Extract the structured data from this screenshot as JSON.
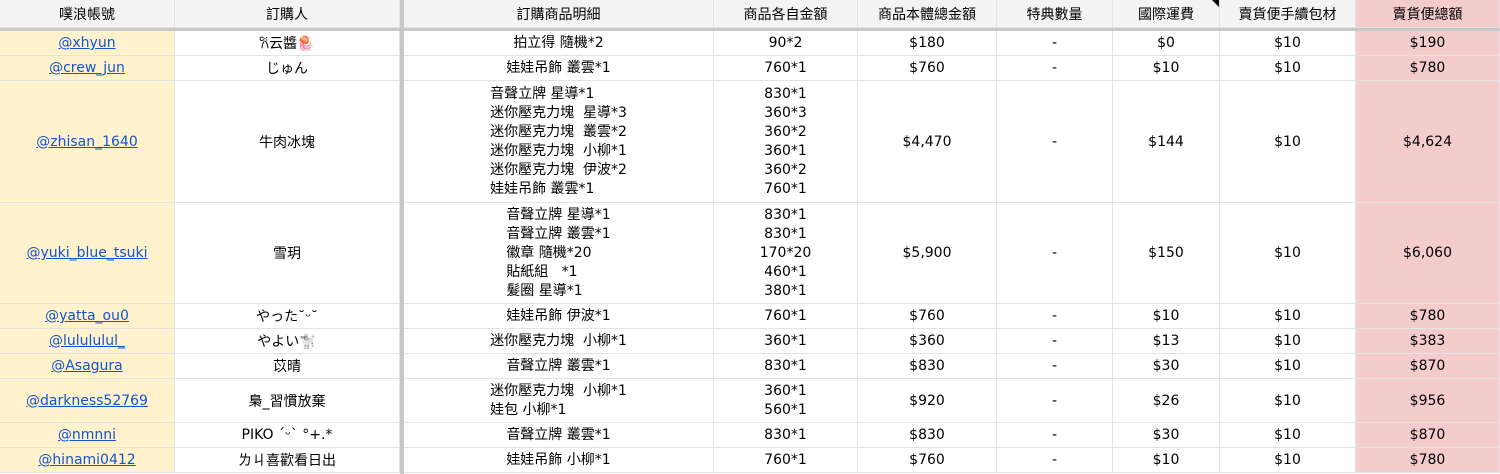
{
  "header": {
    "account": "噗浪帳號",
    "buyer": "訂購人",
    "items": "訂購商品明細",
    "unit_price": "商品各自金額",
    "subtotal": "商品本體總金額",
    "bonus": "特典數量",
    "shipping": "國際運費",
    "handling": "賣貨便手續包材",
    "total": "賣貨便總額"
  },
  "rows": [
    {
      "account": "@xhyun",
      "buyer": "𐙚云醬🪼",
      "items": [
        "拍立得 隨機*2"
      ],
      "prices": [
        "90*2"
      ],
      "subtotal": "$180",
      "bonus": "-",
      "shipping": "$0",
      "handling": "$10",
      "total": "$190"
    },
    {
      "account": "@crew_jun",
      "buyer": "じゅん",
      "items": [
        "娃娃吊飾 叢雲*1"
      ],
      "prices": [
        "760*1"
      ],
      "subtotal": "$760",
      "bonus": "-",
      "shipping": "$10",
      "handling": "$10",
      "total": "$780"
    },
    {
      "account": "@zhisan_1640",
      "buyer": "牛肉冰塊",
      "items": [
        "音聲立牌 星導*1",
        "迷你壓克力塊  星導*3",
        "迷你壓克力塊  叢雲*2",
        "迷你壓克力塊  小柳*1",
        "迷你壓克力塊  伊波*2",
        "娃娃吊飾 叢雲*1"
      ],
      "prices": [
        "830*1",
        "360*3",
        "360*2",
        "360*1",
        "360*2",
        "760*1"
      ],
      "subtotal": "$4,470",
      "bonus": "-",
      "shipping": "$144",
      "handling": "$10",
      "total": "$4,624"
    },
    {
      "account": "@yuki_blue_tsuki",
      "buyer": "雪玥",
      "items": [
        "音聲立牌 星導*1",
        "音聲立牌 叢雲*1",
        "徽章 隨機*20",
        "貼紙組   *1",
        "髮圈 星導*1"
      ],
      "prices": [
        "830*1",
        "830*1",
        "170*20",
        "460*1",
        "380*1"
      ],
      "subtotal": "$5,900",
      "bonus": "-",
      "shipping": "$150",
      "handling": "$10",
      "total": "$6,060"
    },
    {
      "account": "@yatta_ou0",
      "buyer": "やった˘ᵕ˘",
      "items": [
        "娃娃吊飾 伊波*1"
      ],
      "prices": [
        "760*1"
      ],
      "subtotal": "$760",
      "bonus": "-",
      "shipping": "$10",
      "handling": "$10",
      "total": "$780"
    },
    {
      "account": "@lulululul_",
      "buyer": "やよい🐩",
      "items": [
        "迷你壓克力塊  小柳*1"
      ],
      "prices": [
        "360*1"
      ],
      "subtotal": "$360",
      "bonus": "-",
      "shipping": "$13",
      "handling": "$10",
      "total": "$383"
    },
    {
      "account": "@Asagura",
      "buyer": "苡晴",
      "items": [
        "音聲立牌 叢雲*1"
      ],
      "prices": [
        "830*1"
      ],
      "subtotal": "$830",
      "bonus": "-",
      "shipping": "$30",
      "handling": "$10",
      "total": "$870"
    },
    {
      "account": "@darkness52769",
      "buyer": "梟_習慣放棄",
      "items": [
        "迷你壓克力塊  小柳*1",
        "娃包 小柳*1"
      ],
      "prices": [
        "360*1",
        "560*1"
      ],
      "subtotal": "$920",
      "bonus": "-",
      "shipping": "$26",
      "handling": "$10",
      "total": "$956"
    },
    {
      "account": "@nmnni",
      "buyer": "PIKO ´ᵕ` °+.*",
      "items": [
        "音聲立牌 叢雲*1"
      ],
      "prices": [
        "830*1"
      ],
      "subtotal": "$830",
      "bonus": "-",
      "shipping": "$30",
      "handling": "$10",
      "total": "$870"
    },
    {
      "account": "@hinami0412",
      "buyer": "ㄌㄐ喜歡看日出",
      "items": [
        "娃娃吊飾 小柳*1"
      ],
      "prices": [
        "760*1"
      ],
      "subtotal": "$760",
      "bonus": "-",
      "shipping": "$10",
      "handling": "$10",
      "total": "$780"
    }
  ]
}
